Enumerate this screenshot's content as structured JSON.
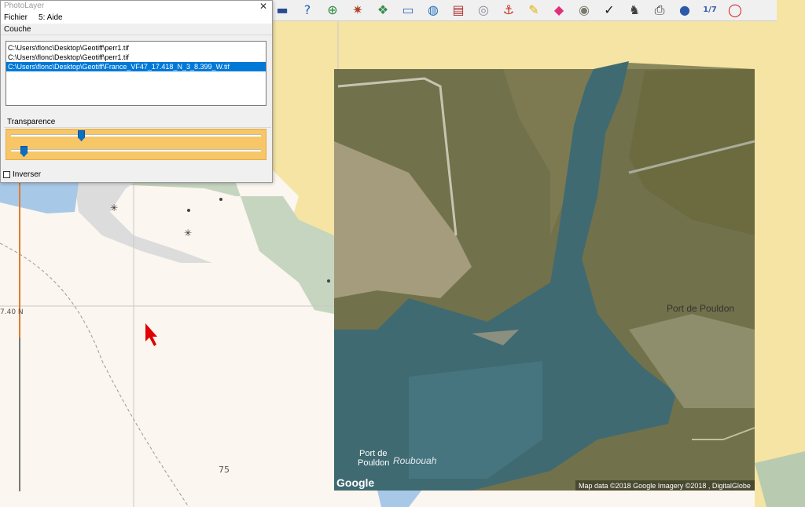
{
  "window": {
    "title": "PhotoLayer",
    "close_glyph": "✕",
    "menu": [
      "Fichier",
      "5: Aide"
    ],
    "layer_group_title": "Couche",
    "layers": [
      "C:\\Users\\flonc\\Desktop\\Geotiff\\perr1.tif",
      "C:\\Users\\flonc\\Desktop\\Geotiff\\perr1.tif",
      "C:\\Users\\flonc\\Desktop\\Geotiff\\France_VF47_17.418_N_3_8.399_W.tif"
    ],
    "selected_layer_index": 2,
    "transparency_title": "Transparence",
    "slider_values": [
      0.28,
      0.05
    ],
    "slider_color": "#f6c667",
    "invert_label": "Inverser",
    "invert_checked": false
  },
  "toolbar": {
    "icons": [
      {
        "name": "map-strip-icon",
        "glyph": "▬",
        "color": "#2a4c8f"
      },
      {
        "name": "help-icon",
        "glyph": "?",
        "color": "#1f5fb0"
      },
      {
        "name": "target-icon",
        "glyph": "⊕",
        "color": "#2a8a3a"
      },
      {
        "name": "satellite-icon",
        "glyph": "✷",
        "color": "#b0442a"
      },
      {
        "name": "layers-icon",
        "glyph": "❖",
        "color": "#3a8a4a"
      },
      {
        "name": "portolan-icon",
        "glyph": "▭",
        "color": "#3a6fb0"
      },
      {
        "name": "globe-icon",
        "glyph": "◍",
        "color": "#2470b8"
      },
      {
        "name": "chart-icon",
        "glyph": "▤",
        "color": "#b03030"
      },
      {
        "name": "radar-icon",
        "glyph": "◎",
        "color": "#8a8a9a"
      },
      {
        "name": "anchor-icon",
        "glyph": "⚓",
        "color": "#c03020"
      },
      {
        "name": "pencil-icon",
        "glyph": "✎",
        "color": "#e0b000"
      },
      {
        "name": "eraser-icon",
        "glyph": "◆",
        "color": "#e0307a"
      },
      {
        "name": "compass-icon",
        "glyph": "◉",
        "color": "#7a7a6a"
      },
      {
        "name": "route-icon",
        "glyph": "✓",
        "color": "#1a1a1a"
      },
      {
        "name": "dog-icon",
        "glyph": "♞",
        "color": "#404040"
      },
      {
        "name": "printer-icon",
        "glyph": "⎙",
        "color": "#303030"
      },
      {
        "name": "world-icon",
        "glyph": "●",
        "color": "#2b58a8"
      },
      {
        "name": "scale-icon",
        "glyph": "1/7",
        "color": "#3a5ea8"
      },
      {
        "name": "lifebuoy-icon",
        "glyph": "◯",
        "color": "#d02020"
      }
    ]
  },
  "map": {
    "chart_labels": {
      "latitude": "7.40 N",
      "sounding": "75",
      "port_name": "Port de Pouldon"
    },
    "satellite_labels": {
      "place1": "Port de",
      "place2": "Pouldon",
      "bay_name": "Roubouah",
      "google_logo": "Google",
      "attribution": "Map data ©2018 Google  Imagery ©2018 , DigitalGlobe"
    },
    "colors": {
      "sea": "#fbf6ef",
      "land": "#f5e4a3",
      "shallow": "#b8cbb0",
      "deep_water": "#3a6d7c",
      "cursor": "#e00000"
    }
  }
}
